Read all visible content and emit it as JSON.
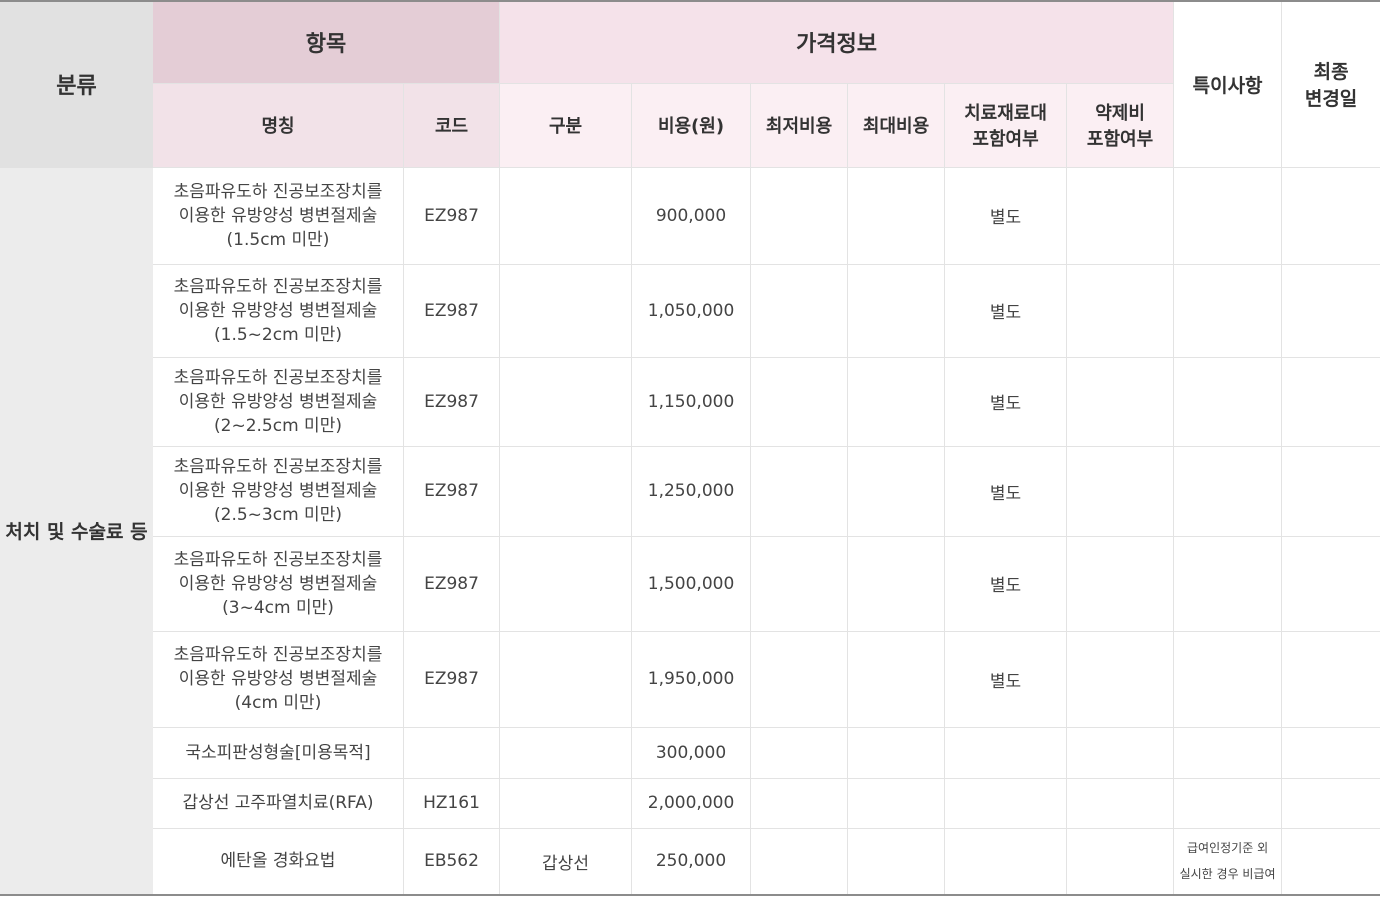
{
  "header": {
    "category": "분류",
    "item_group": "항목",
    "price_group": "가격정보",
    "special": "특이사항",
    "last_changed": [
      "최종",
      "변경일"
    ],
    "name": "명칭",
    "code": "코드",
    "division": "구분",
    "cost": "비용(원)",
    "min_cost": "최저비용",
    "max_cost": "최대비용",
    "material": [
      "치료재료대",
      "포함여부"
    ],
    "drug": [
      "약제비",
      "포함여부"
    ]
  },
  "category_label": "처치 및 수술료 등",
  "rows": [
    {
      "name": [
        "초음파유도하 진공보조장치를",
        "이용한 유방양성 병변절제술",
        "(1.5cm 미만)"
      ],
      "code": "EZ987",
      "division": "",
      "cost": "900,000",
      "min": "",
      "max": "",
      "material": "별도",
      "drug": "",
      "note": [],
      "changed": ""
    },
    {
      "name": [
        "초음파유도하 진공보조장치를",
        "이용한 유방양성 병변절제술",
        "(1.5~2cm 미만)"
      ],
      "code": "EZ987",
      "division": "",
      "cost": "1,050,000",
      "min": "",
      "max": "",
      "material": "별도",
      "drug": "",
      "note": [],
      "changed": ""
    },
    {
      "name": [
        "초음파유도하 진공보조장치를",
        "이용한 유방양성 병변절제술",
        "(2~2.5cm 미만)"
      ],
      "code": "EZ987",
      "division": "",
      "cost": "1,150,000",
      "min": "",
      "max": "",
      "material": "별도",
      "drug": "",
      "note": [],
      "changed": ""
    },
    {
      "name": [
        "초음파유도하 진공보조장치를",
        "이용한 유방양성 병변절제술",
        "(2.5~3cm 미만)"
      ],
      "code": "EZ987",
      "division": "",
      "cost": "1,250,000",
      "min": "",
      "max": "",
      "material": "별도",
      "drug": "",
      "note": [],
      "changed": ""
    },
    {
      "name": [
        "초음파유도하 진공보조장치를",
        "이용한 유방양성 병변절제술",
        "(3~4cm 미만)"
      ],
      "code": "EZ987",
      "division": "",
      "cost": "1,500,000",
      "min": "",
      "max": "",
      "material": "별도",
      "drug": "",
      "note": [],
      "changed": ""
    },
    {
      "name": [
        "초음파유도하 진공보조장치를",
        "이용한 유방양성 병변절제술",
        "(4cm 미만)"
      ],
      "code": "EZ987",
      "division": "",
      "cost": "1,950,000",
      "min": "",
      "max": "",
      "material": "별도",
      "drug": "",
      "note": [],
      "changed": ""
    },
    {
      "name": [
        "국소피판성형술[미용목적]"
      ],
      "code": "",
      "division": "",
      "cost": "300,000",
      "min": "",
      "max": "",
      "material": "",
      "drug": "",
      "note": [],
      "changed": ""
    },
    {
      "name": [
        "갑상선 고주파열치료(RFA)"
      ],
      "code": "HZ161",
      "division": "",
      "cost": "2,000,000",
      "min": "",
      "max": "",
      "material": "",
      "drug": "",
      "note": [],
      "changed": ""
    },
    {
      "name": [
        "에탄올 경화요법"
      ],
      "code": "EB562",
      "division": "갑상선",
      "cost": "250,000",
      "min": "",
      "max": "",
      "material": "",
      "drug": "",
      "note": [
        "급여인정기준 외",
        "실시한 경우 비급여"
      ],
      "changed": ""
    }
  ]
}
